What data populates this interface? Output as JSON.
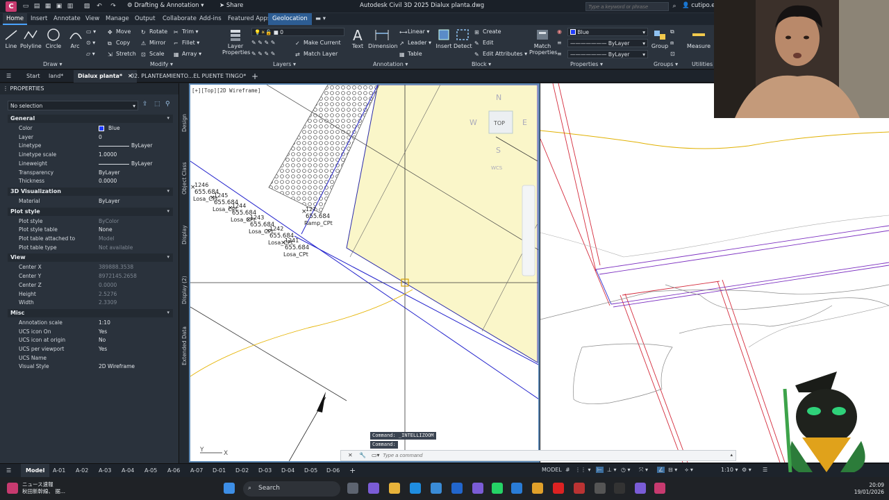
{
  "titlebar": {
    "app_letter": "C",
    "workspace": "Drafting & Annotation",
    "share": "Share",
    "title": "Autodesk Civil 3D 2025   Dialux planta.dwg",
    "search_placeholder": "Type a keyword or phrase",
    "user": "cutipo.e"
  },
  "ribbon_tabs": [
    "Home",
    "Insert",
    "Annotate",
    "View",
    "Manage",
    "Output",
    "Collaborate",
    "Add-ins",
    "Featured Apps",
    "Geolocation"
  ],
  "ribbon": {
    "draw": {
      "line": "Line",
      "polyline": "Polyline",
      "circle": "Circle",
      "arc": "Arc",
      "panel": "Draw"
    },
    "modify": {
      "move": "Move",
      "rotate": "Rotate",
      "trim": "Trim",
      "copy": "Copy",
      "mirror": "Mirror",
      "fillet": "Fillet",
      "stretch": "Stretch",
      "scale": "Scale",
      "array": "Array",
      "panel": "Modify"
    },
    "layers": {
      "layer_properties": "Layer Properties",
      "layer_value": "0",
      "make_current": "Make Current",
      "match_layer": "Match Layer",
      "panel": "Layers"
    },
    "annotation": {
      "text": "Text",
      "dimension": "Dimension",
      "linear": "Linear",
      "leader": "Leader",
      "table": "Table",
      "panel": "Annotation"
    },
    "block": {
      "insert": "Insert",
      "detect": "Detect",
      "create": "Create",
      "edit": "Edit",
      "edit_attributes": "Edit Attributes",
      "panel": "Block"
    },
    "properties": {
      "match_properties": "Match Properties",
      "color": "Blue",
      "linetype": "ByLayer",
      "lineweight": "ByLayer",
      "panel": "Properties"
    },
    "groups": {
      "group": "Group",
      "panel": "Groups"
    },
    "utilities": {
      "measure": "Measure",
      "panel": "Utilities"
    }
  },
  "doc_tabs": [
    "Start",
    "land*",
    "Dialux planta*",
    "02. PLANTEAMIENTO...EL PUENTE TINGO*"
  ],
  "properties": {
    "title": "PROPERTIES",
    "selection": "No selection",
    "sections": [
      {
        "name": "General",
        "rows": [
          [
            "Color",
            "Blue"
          ],
          [
            "Layer",
            "0"
          ],
          [
            "Linetype",
            "ByLayer"
          ],
          [
            "Linetype scale",
            "1.0000"
          ],
          [
            "Lineweight",
            "ByLayer"
          ],
          [
            "Transparency",
            "ByLayer"
          ],
          [
            "Thickness",
            "0.0000"
          ]
        ]
      },
      {
        "name": "3D Visualization",
        "rows": [
          [
            "Material",
            "ByLayer"
          ]
        ]
      },
      {
        "name": "Plot style",
        "rows": [
          [
            "Plot style",
            "ByColor"
          ],
          [
            "Plot style table",
            "None"
          ],
          [
            "Plot table attached to",
            "Model"
          ],
          [
            "Plot table type",
            "Not available"
          ]
        ]
      },
      {
        "name": "View",
        "rows": [
          [
            "Center X",
            "389888.3538"
          ],
          [
            "Center Y",
            "8972145.2658"
          ],
          [
            "Center Z",
            "0.0000"
          ],
          [
            "Height",
            "2.5276"
          ],
          [
            "Width",
            "2.3309"
          ]
        ]
      },
      {
        "name": "Misc",
        "rows": [
          [
            "Annotation scale",
            "1:10"
          ],
          [
            "UCS icon On",
            "Yes"
          ],
          [
            "UCS icon at origin",
            "No"
          ],
          [
            "UCS per viewport",
            "Yes"
          ],
          [
            "UCS Name",
            ""
          ],
          [
            "Visual Style",
            "2D Wireframe"
          ]
        ]
      }
    ]
  },
  "side_tabs": [
    "Design",
    "Object Class",
    "Display",
    "Display (2)",
    "Extended Data"
  ],
  "viewport": {
    "label": "[+][Top][2D Wireframe]",
    "viewcube": {
      "n": "N",
      "s": "S",
      "e": "E",
      "w": "W",
      "top": "TOP",
      "wcs": "WCS"
    },
    "annotations": [
      {
        "id": "127",
        "elev": "655.684",
        "desc": "Ramp_CPt"
      },
      {
        "id": "1246",
        "elev": "655.684",
        "desc": "Losa_CPt"
      },
      {
        "id": "1245",
        "elev": "655.684",
        "desc": "Losa_CPt"
      },
      {
        "id": "1244",
        "elev": "655.684",
        "desc": "Losa_CPt"
      },
      {
        "id": "1243",
        "elev": "655.684",
        "desc": "Losa_CPt"
      },
      {
        "id": "1242",
        "elev": "655.684",
        "desc": "Losa_CPt"
      },
      {
        "id": "1241",
        "elev": "655.684",
        "desc": "Losa_CPt"
      }
    ],
    "ucs_y": "Y",
    "ucs_x": "X"
  },
  "command": {
    "history1": "Command: _INTELLIZOOM",
    "history2": "Command:",
    "placeholder": "Type a command"
  },
  "layout_tabs": [
    "Model",
    "A-01",
    "A-02",
    "A-03",
    "A-04",
    "A-05",
    "A-06",
    "A-07",
    "D-01",
    "D-02",
    "D-03",
    "D-04",
    "D-05",
    "D-06"
  ],
  "status": {
    "model": "MODEL",
    "scale": "1:10"
  },
  "taskbar": {
    "news_line1": "ニュース速報",
    "news_line2": "秋田新幹線、 据...",
    "search": "Search",
    "time": "20:09",
    "date": "19/01/2026"
  },
  "colors": {
    "accent": "#4aa3ff",
    "tab_active": "#2d5d93",
    "blue_line": "#2222cc",
    "red_line": "#d42a3b",
    "purple_line": "#7b2fc0",
    "yellow_fill": "#faf6c9"
  }
}
